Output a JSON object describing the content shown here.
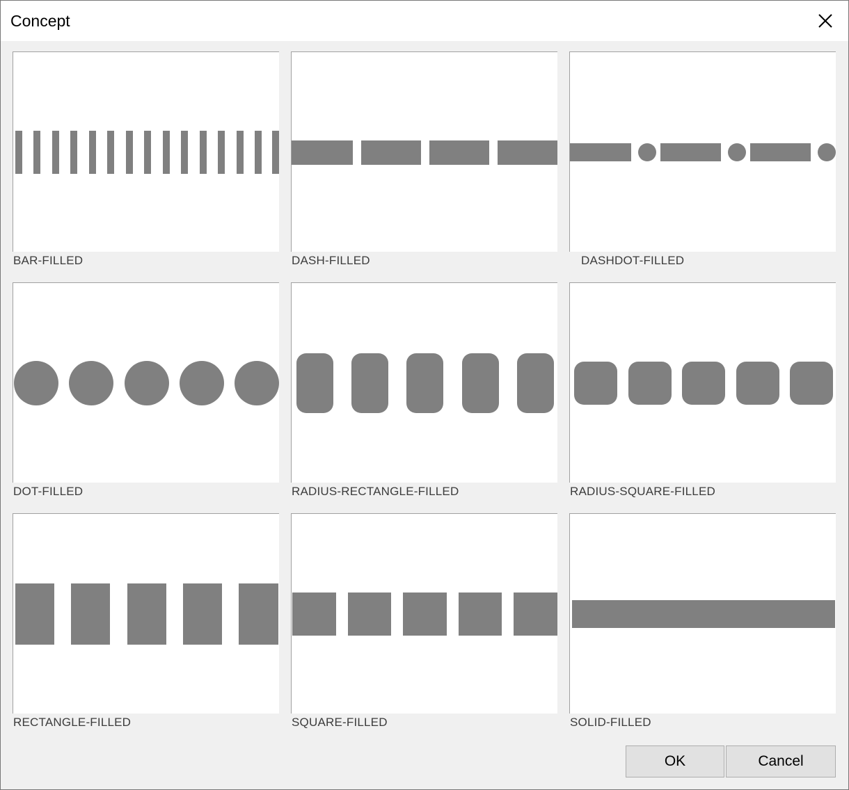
{
  "window": {
    "title": "Concept"
  },
  "pattern_color": "#808080",
  "tiles": [
    {
      "name": "bar-filled",
      "caption": "BAR-FILLED"
    },
    {
      "name": "dash-filled",
      "caption": "DASH-FILLED"
    },
    {
      "name": "dashdot-filled",
      "caption": "DASHDOT-FILLED"
    },
    {
      "name": "dot-filled",
      "caption": "DOT-FILLED"
    },
    {
      "name": "radius-rectangle-filled",
      "caption": "RADIUS-RECTANGLE-FILLED"
    },
    {
      "name": "radius-square-filled",
      "caption": "RADIUS-SQUARE-FILLED"
    },
    {
      "name": "rectangle-filled",
      "caption": "RECTANGLE-FILLED"
    },
    {
      "name": "square-filled",
      "caption": "SQUARE-FILLED"
    },
    {
      "name": "solid-filled",
      "caption": "SOLID-FILLED"
    }
  ],
  "buttons": {
    "ok": "OK",
    "cancel": "Cancel"
  }
}
